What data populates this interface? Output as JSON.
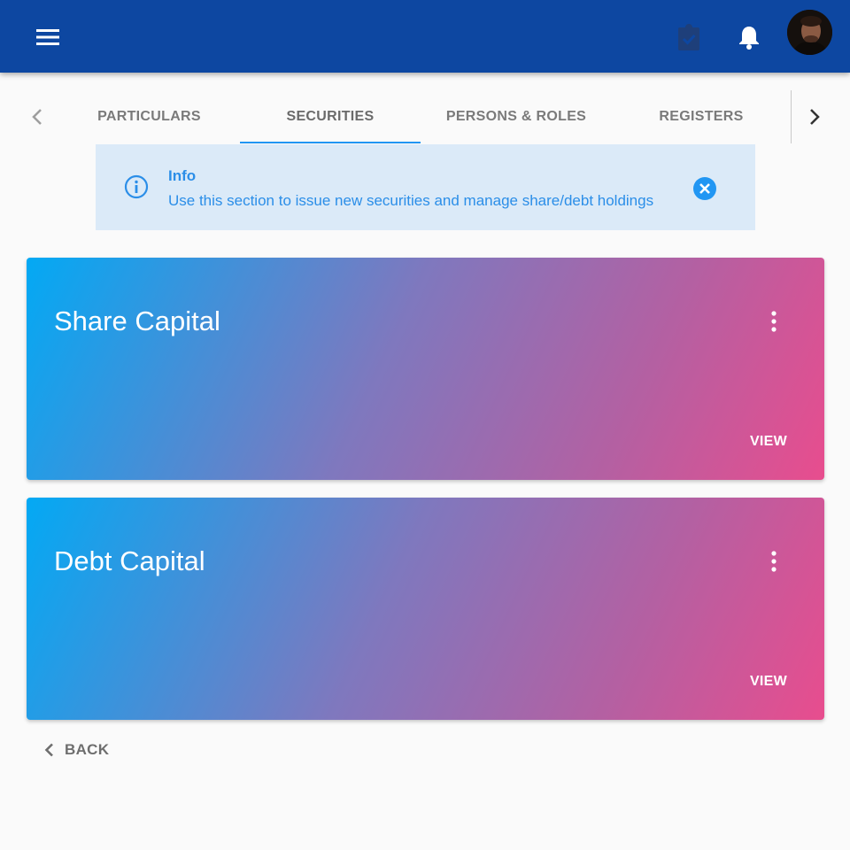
{
  "colors": {
    "appbar": "#0d47a1",
    "tab_active_indicator": "#2196f3",
    "info_bg": "#dbeaf8",
    "info_text": "#2b8ee8",
    "card_gradient_start": "#03a9f4",
    "card_gradient_end": "#e84d8e"
  },
  "appbar": {
    "icons": [
      "menu-icon",
      "clipboard-check-icon",
      "bell-icon"
    ]
  },
  "tabs": [
    {
      "label": "PARTICULARS",
      "active": false
    },
    {
      "label": "SECURITIES",
      "active": true
    },
    {
      "label": "PERSONS & ROLES",
      "active": false
    },
    {
      "label": "REGISTERS",
      "active": false
    }
  ],
  "info": {
    "title": "Info",
    "message": "Use this section to issue new securities and manage share/debt holdings"
  },
  "cards": [
    {
      "title": "Share Capital",
      "action": "VIEW"
    },
    {
      "title": "Debt Capital",
      "action": "VIEW"
    }
  ],
  "footer": {
    "back_label": "BACK"
  }
}
